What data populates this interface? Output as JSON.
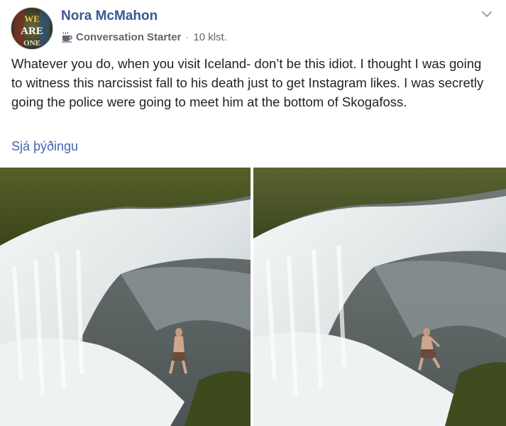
{
  "post": {
    "author": "Nora McMahon",
    "badge": {
      "icon": "coffee-cup-icon",
      "label": "Conversation Starter"
    },
    "separator": "·",
    "time": "10 klst.",
    "menu_icon": "chevron-down-icon",
    "text": "Whatever you do, when you visit Iceland- don’t be this idiot. I thought I was going to witness this narcissist fall to his death just to get Instagram likes. I was secretly going the police were going to meet him at the bottom of Skogafoss.",
    "translate_label": "Sjá þýðingu",
    "avatar": {
      "text_lines": [
        "WE",
        "ARE",
        "ONE"
      ]
    },
    "photos": [
      {
        "icon": "waterfall-photo"
      },
      {
        "icon": "waterfall-photo"
      }
    ]
  },
  "colors": {
    "author": "#385898",
    "link": "#4267b2",
    "text": "#1d2129",
    "meta": "#616770"
  }
}
